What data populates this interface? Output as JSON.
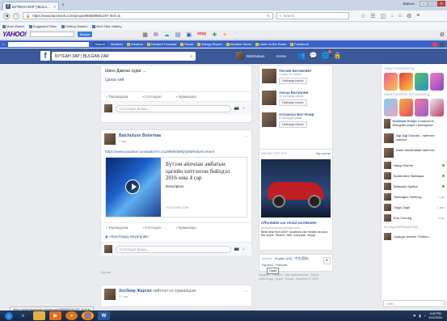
{
  "browser": {
    "tab_title": "БУТЕАН ЗАР | BULA...",
    "url": "https://www.facebook.com/groups/806089061297 9ref=ts",
    "search_placeholder": "Search",
    "window_user": "Battuur",
    "bookmarks": [
      "Most Visited",
      "Suggested Sites",
      "Getting Started",
      "Web Slice Gallery"
    ]
  },
  "yahoo": {
    "logo": "YAHOO!",
    "search_button": "Search",
    "weather_toolbar": "Weather",
    "weather_links": [
      "Weather",
      "Detailed Forecast",
      "Radar",
      "Allergy Report",
      "Weather News",
      "Listen to the Radio",
      "Facebook"
    ]
  },
  "facebook": {
    "group_name": "БУТЕАН ЗАР | BULGAN ZAR",
    "profile_name": "Batchuluun",
    "home_label": "Home",
    "notif_badge": "1"
  },
  "post1": {
    "text_line": "Шинэ Давлах худаг ...",
    "text_line2": "Цагаа хий",
    "actions": [
      "Таалагдлаа",
      "Сэтгэгдэл",
      "Хуваалцах"
    ],
    "comment_placeholder": "Сэтгэгдэл бичих..."
  },
  "post2": {
    "author": "Batchuluun Bolormaa",
    "time": "7 цаг",
    "link": "https://www.youtube.com/watch?v=zuJ9869469QQ0&feature=share",
    "video_title": "Бүтээн айлчлан амбатын цагийн хиттэнээн бийлдэл 2016 оны 4 сар",
    "video_desc": "Description",
    "video_source": "YOUTUBE.COM",
    "actions": [
      "Таалагдлаа",
      "Сэтгэгдэл",
      "Хуваалцах"
    ],
    "shared_by": "Altanshagay Bayargalan",
    "comment_placeholder": "Сэтгэгдэл бичих..."
  },
  "older": {
    "label": "Хуучин",
    "author": "Хосбаяр Жаргал",
    "meta": "нийтлэл нэ хуваалцсан",
    "time": "17 цаг"
  },
  "suggestions": [
    {
      "name": "Төгсөө Батчөлөөт",
      "sub": "4 найз нь хуваа",
      "btn": "Найзаар нэмэх"
    },
    {
      "name": "Амгаа Батчөлөө",
      "sub": "10 найзууд хуваа",
      "btn": "Найзаар нэмэх"
    },
    {
      "name": "Алтансүх Бат-Очир",
      "sub": "6 найзууд хуваа",
      "btn": "Найзаар нэмэх"
    }
  ],
  "sponsored": {
    "label": "ИВЭЭН ТЭТГЭГЧ",
    "create_ad": "Зар үүсгэх",
    "ad_title": "Affordable car rental worldwide!",
    "ad_url": "www.economybookings.com",
    "ad_desc": "Best deal from 800+ locations car rentals around the world. Search, free, compare, enjoy!"
  },
  "language": {
    "label": "Монгол",
    "options": [
      "English (US)",
      "中文(简体)",
      "Español",
      "Français"
    ],
    "tooltip": "Gaalt"
  },
  "footer": "Нууцлал · Нөхцөл · Зар сурталчилгаа · Зарын сонголтууд · Күүки · Бусад · Facebook © 2016",
  "chat": {
    "header": "ТАНЫ ТОГЛООМУУД",
    "games_label": "САНАЛ БОЛГОХ ТОГЛООМУУД",
    "stories": [
      {
        "name": "Dolzhaat Duujia",
        "text": "Сонирхсон Mongolia кларе таалагдсан"
      },
      {
        "name": "Ogi Ogi",
        "text": "Golodai - нийтлэл нэмсэн"
      }
    ],
    "third": "Kadri Munkhaatar нийтлэл",
    "contacts": [
      {
        "name": "Naugi Shirine",
        "status": "online"
      },
      {
        "name": "Bolderdene Batbayar",
        "status": "online"
      },
      {
        "name": "Batbayar Sjartka",
        "status": "online"
      },
      {
        "name": "Tserbagee Tserbeg...",
        "status": "1 цаг"
      },
      {
        "name": "Oagii Oagii",
        "status": "1 мин"
      },
      {
        "name": "Enh Chimeg",
        "status": "5 цаг"
      }
    ],
    "more_label": "БУСАД ХАРИЛЦАГЧИД",
    "more_contact": "Uyanga. Aewed. Enkhtu...",
    "search_placeholder": "Хайх"
  },
  "status_url": "https://www.facebook.com/groups/806089061297 9ref=ts",
  "taskbar": {
    "time": "4:42 PM",
    "date": "4/11/2016"
  }
}
